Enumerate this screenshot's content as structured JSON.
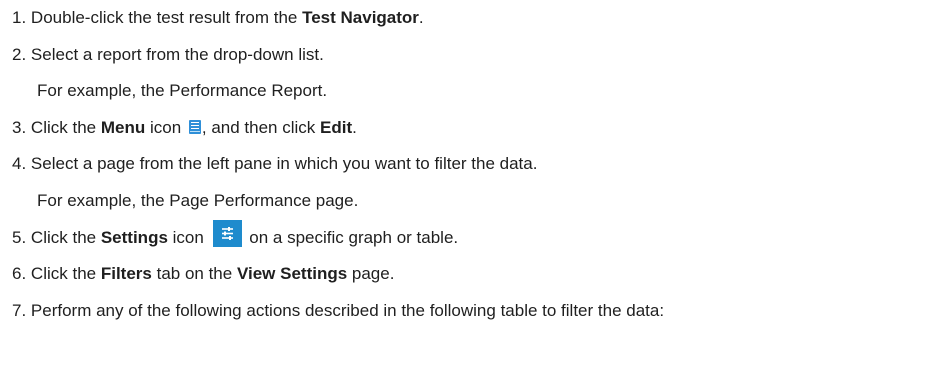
{
  "steps": [
    {
      "number": "1.",
      "before": "Double-click the test result from the ",
      "bold1": "Test Navigator",
      "after": "."
    },
    {
      "number": "2.",
      "text": "Select a report from the drop-down list.",
      "example": "For example, the Performance Report."
    },
    {
      "number": "3.",
      "before": "Click the ",
      "bold1": "Menu",
      "middle": " icon ",
      "middle2": ", and then click ",
      "bold2": "Edit",
      "after": "."
    },
    {
      "number": "4.",
      "text": "Select a page from the left pane in which you want to filter the data.",
      "example": "For example, the Page Performance page."
    },
    {
      "number": "5.",
      "before": "Click the ",
      "bold1": "Settings",
      "middle": " icon ",
      "after": " on a specific graph or table."
    },
    {
      "number": "6.",
      "before": "Click the ",
      "bold1": "Filters",
      "middle": " tab on the ",
      "bold2": "View Settings",
      "after": " page."
    },
    {
      "number": "7.",
      "text": "Perform any of the following actions described in the following table to filter the data:"
    }
  ],
  "icons": {
    "menu": "menu-icon",
    "settings": "settings-sliders-icon",
    "menu_color": "#2f8fd8",
    "settings_color": "#1e8bcd"
  }
}
